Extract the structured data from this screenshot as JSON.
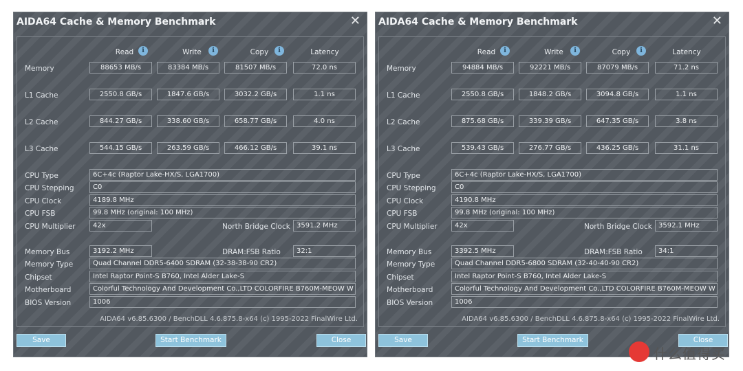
{
  "windows": [
    {
      "title": "AIDA64 Cache & Memory Benchmark",
      "headers": {
        "read": "Read",
        "write": "Write",
        "copy": "Copy",
        "latency": "Latency"
      },
      "rows": [
        {
          "label": "Memory",
          "read": "88653 MB/s",
          "write": "83384 MB/s",
          "copy": "81507 MB/s",
          "latency": "72.0 ns"
        },
        {
          "label": "L1 Cache",
          "read": "2550.8 GB/s",
          "write": "1847.6 GB/s",
          "copy": "3032.2 GB/s",
          "latency": "1.1 ns"
        },
        {
          "label": "L2 Cache",
          "read": "844.27 GB/s",
          "write": "338.60 GB/s",
          "copy": "658.77 GB/s",
          "latency": "4.0 ns"
        },
        {
          "label": "L3 Cache",
          "read": "544.15 GB/s",
          "write": "263.59 GB/s",
          "copy": "466.12 GB/s",
          "latency": "39.1 ns"
        }
      ],
      "cpu": {
        "type_label": "CPU Type",
        "type": "6C+4c   (Raptor Lake-HX/S, LGA1700)",
        "stepping_label": "CPU Stepping",
        "stepping": "C0",
        "clock_label": "CPU Clock",
        "clock": "4189.8 MHz",
        "fsb_label": "CPU FSB",
        "fsb": "99.8 MHz  (original: 100 MHz)",
        "multiplier_label": "CPU Multiplier",
        "multiplier": "42x",
        "nb_clock_label": "North Bridge Clock",
        "nb_clock": "3591.2 MHz"
      },
      "mem": {
        "bus_label": "Memory Bus",
        "bus": "3192.2 MHz",
        "ratio_label": "DRAM:FSB Ratio",
        "ratio": "32:1",
        "type_label": "Memory Type",
        "type": "Quad Channel DDR5-6400 SDRAM  (32-38-38-90 CR2)",
        "chipset_label": "Chipset",
        "chipset": "Intel Raptor Point-S B760, Intel Alder Lake-S",
        "motherboard_label": "Motherboard",
        "motherboard": "Colorful Technology And Development Co.,LTD COLORFIRE B760M-MEOW W",
        "bios_label": "BIOS Version",
        "bios": "1006"
      },
      "footer": "AIDA64 v6.85.6300 / BenchDLL 4.6.875.8-x64  (c) 1995-2022 FinalWire Ltd.",
      "buttons": {
        "save": "Save",
        "start": "Start Benchmark",
        "close": "Close"
      }
    },
    {
      "title": "AIDA64 Cache & Memory Benchmark",
      "headers": {
        "read": "Read",
        "write": "Write",
        "copy": "Copy",
        "latency": "Latency"
      },
      "rows": [
        {
          "label": "Memory",
          "read": "94884 MB/s",
          "write": "92221 MB/s",
          "copy": "87079 MB/s",
          "latency": "71.2 ns"
        },
        {
          "label": "L1 Cache",
          "read": "2550.8 GB/s",
          "write": "1848.2 GB/s",
          "copy": "3094.8 GB/s",
          "latency": "1.1 ns"
        },
        {
          "label": "L2 Cache",
          "read": "875.68 GB/s",
          "write": "339.39 GB/s",
          "copy": "647.35 GB/s",
          "latency": "3.8 ns"
        },
        {
          "label": "L3 Cache",
          "read": "539.43 GB/s",
          "write": "276.77 GB/s",
          "copy": "436.25 GB/s",
          "latency": "31.1 ns"
        }
      ],
      "cpu": {
        "type_label": "CPU Type",
        "type": "6C+4c   (Raptor Lake-HX/S, LGA1700)",
        "stepping_label": "CPU Stepping",
        "stepping": "C0",
        "clock_label": "CPU Clock",
        "clock": "4190.8 MHz",
        "fsb_label": "CPU FSB",
        "fsb": "99.8 MHz  (original: 100 MHz)",
        "multiplier_label": "CPU Multiplier",
        "multiplier": "42x",
        "nb_clock_label": "North Bridge Clock",
        "nb_clock": "3592.1 MHz"
      },
      "mem": {
        "bus_label": "Memory Bus",
        "bus": "3392.5 MHz",
        "ratio_label": "DRAM:FSB Ratio",
        "ratio": "34:1",
        "type_label": "Memory Type",
        "type": "Quad Channel DDR5-6800 SDRAM  (32-40-40-90 CR2)",
        "chipset_label": "Chipset",
        "chipset": "Intel Raptor Point-S B760, Intel Alder Lake-S",
        "motherboard_label": "Motherboard",
        "motherboard": "Colorful Technology And Development Co.,LTD COLORFIRE B760M-MEOW W",
        "bios_label": "BIOS Version",
        "bios": "1006"
      },
      "footer": "AIDA64 v6.85.6300 / BenchDLL 4.6.875.8-x64  (c) 1995-2022 FinalWire Ltd.",
      "buttons": {
        "save": "Save",
        "start": "Start Benchmark",
        "close": "Close"
      }
    }
  ],
  "watermark": {
    "text": "什么值得买"
  },
  "colors": {
    "window_bg": "#555b62",
    "button_bg": "#8ec3dc",
    "info_icon": "#7fb6dd",
    "logo_red": "#e53935"
  },
  "icons": {
    "info": "info-icon",
    "close": "close-icon"
  }
}
